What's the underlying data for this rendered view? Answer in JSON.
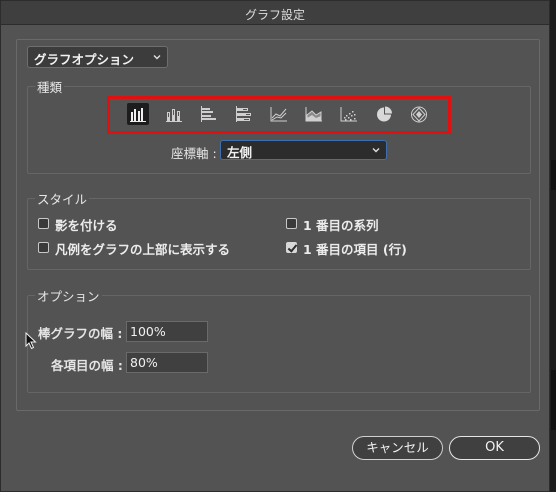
{
  "window": {
    "title": "グラフ設定"
  },
  "options_select": {
    "value": "グラフオプション"
  },
  "type_section": {
    "label": "種類",
    "icons": [
      {
        "name": "grouped-column-graph-icon",
        "selected": true
      },
      {
        "name": "stacked-column-graph-icon",
        "selected": false
      },
      {
        "name": "grouped-bar-graph-icon",
        "selected": false
      },
      {
        "name": "stacked-bar-graph-icon",
        "selected": false
      },
      {
        "name": "line-graph-icon",
        "selected": false
      },
      {
        "name": "area-graph-icon",
        "selected": false
      },
      {
        "name": "scatter-graph-icon",
        "selected": false
      },
      {
        "name": "pie-graph-icon",
        "selected": false
      },
      {
        "name": "radar-graph-icon",
        "selected": false
      }
    ],
    "axis_label": "座標軸 :",
    "axis_value": "左側"
  },
  "style_section": {
    "label": "スタイル",
    "add_shadow": {
      "label": "影を付ける",
      "checked": false
    },
    "legend_top": {
      "label": "凡例をグラフの上部に表示する",
      "checked": false
    },
    "first_row": {
      "label": "1 番目の系列",
      "checked": false
    },
    "first_column": {
      "label": "1 番目の項目 (行)",
      "checked": true
    }
  },
  "options_section": {
    "label": "オプション",
    "column_width_label": "棒グラフの幅 :",
    "column_width_value": "100%",
    "cluster_width_label": "各項目の幅 :",
    "cluster_width_value": "80%"
  },
  "buttons": {
    "cancel": "キャンセル",
    "ok": "OK"
  },
  "colors": {
    "highlight": "#e01010",
    "dialog_bg": "#535353",
    "focus": "#3f6fb0"
  }
}
